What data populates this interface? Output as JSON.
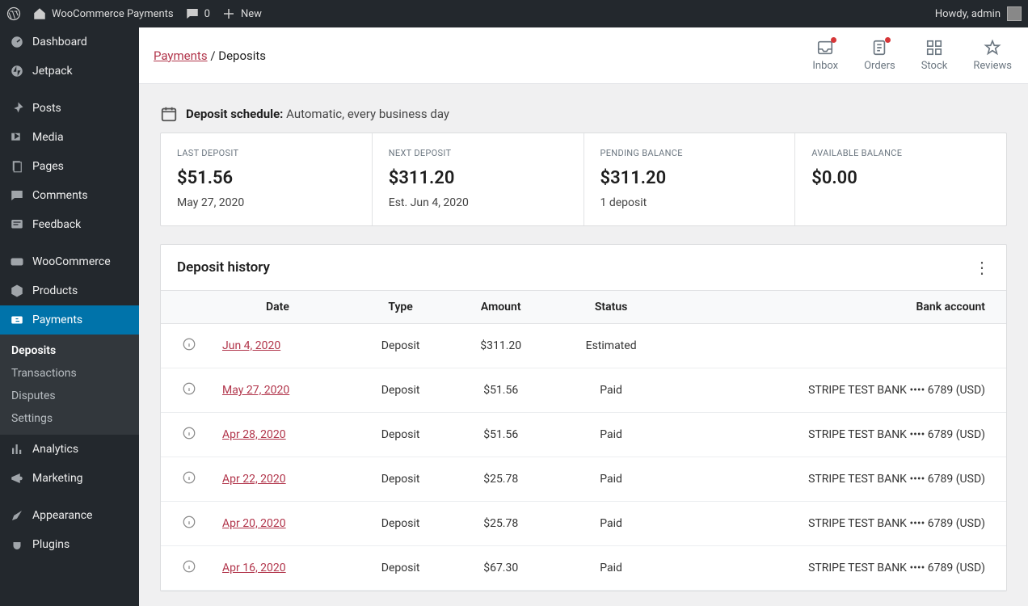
{
  "adminbar": {
    "site_title": "WooCommerce Payments",
    "comments_count": "0",
    "new_label": "New",
    "howdy": "Howdy, admin"
  },
  "sidebar": {
    "items": [
      {
        "label": "Dashboard"
      },
      {
        "label": "Jetpack"
      },
      {
        "label": "Posts"
      },
      {
        "label": "Media"
      },
      {
        "label": "Pages"
      },
      {
        "label": "Comments"
      },
      {
        "label": "Feedback"
      },
      {
        "label": "WooCommerce"
      },
      {
        "label": "Products"
      },
      {
        "label": "Payments"
      },
      {
        "label": "Analytics"
      },
      {
        "label": "Marketing"
      },
      {
        "label": "Appearance"
      },
      {
        "label": "Plugins"
      }
    ],
    "submenu": [
      {
        "label": "Deposits",
        "active": true
      },
      {
        "label": "Transactions"
      },
      {
        "label": "Disputes"
      },
      {
        "label": "Settings"
      }
    ]
  },
  "breadcrumb": {
    "root": "Payments",
    "leaf": "Deposits"
  },
  "topactions": [
    {
      "label": "Inbox",
      "dot": true,
      "icon": "inbox"
    },
    {
      "label": "Orders",
      "dot": true,
      "icon": "orders"
    },
    {
      "label": "Stock",
      "dot": false,
      "icon": "stock"
    },
    {
      "label": "Reviews",
      "dot": false,
      "icon": "reviews"
    }
  ],
  "schedule": {
    "label": "Deposit schedule:",
    "value": "Automatic, every business day"
  },
  "cards": [
    {
      "label": "LAST DEPOSIT",
      "value": "$51.56",
      "sub": "May 27, 2020"
    },
    {
      "label": "NEXT DEPOSIT",
      "value": "$311.20",
      "sub": "Est. Jun 4, 2020"
    },
    {
      "label": "PENDING BALANCE",
      "value": "$311.20",
      "sub": "1 deposit"
    },
    {
      "label": "AVAILABLE BALANCE",
      "value": "$0.00",
      "sub": ""
    }
  ],
  "table": {
    "title": "Deposit history",
    "headers": {
      "date": "Date",
      "type": "Type",
      "amount": "Amount",
      "status": "Status",
      "bank": "Bank account"
    },
    "rows": [
      {
        "date": "Jun 4, 2020",
        "type": "Deposit",
        "amount": "$311.20",
        "status": "Estimated",
        "bank": ""
      },
      {
        "date": "May 27, 2020",
        "type": "Deposit",
        "amount": "$51.56",
        "status": "Paid",
        "bank": "STRIPE TEST BANK •••• 6789 (USD)"
      },
      {
        "date": "Apr 28, 2020",
        "type": "Deposit",
        "amount": "$51.56",
        "status": "Paid",
        "bank": "STRIPE TEST BANK •••• 6789 (USD)"
      },
      {
        "date": "Apr 22, 2020",
        "type": "Deposit",
        "amount": "$25.78",
        "status": "Paid",
        "bank": "STRIPE TEST BANK •••• 6789 (USD)"
      },
      {
        "date": "Apr 20, 2020",
        "type": "Deposit",
        "amount": "$25.78",
        "status": "Paid",
        "bank": "STRIPE TEST BANK •••• 6789 (USD)"
      },
      {
        "date": "Apr 16, 2020",
        "type": "Deposit",
        "amount": "$67.30",
        "status": "Paid",
        "bank": "STRIPE TEST BANK •••• 6789 (USD)"
      }
    ]
  }
}
